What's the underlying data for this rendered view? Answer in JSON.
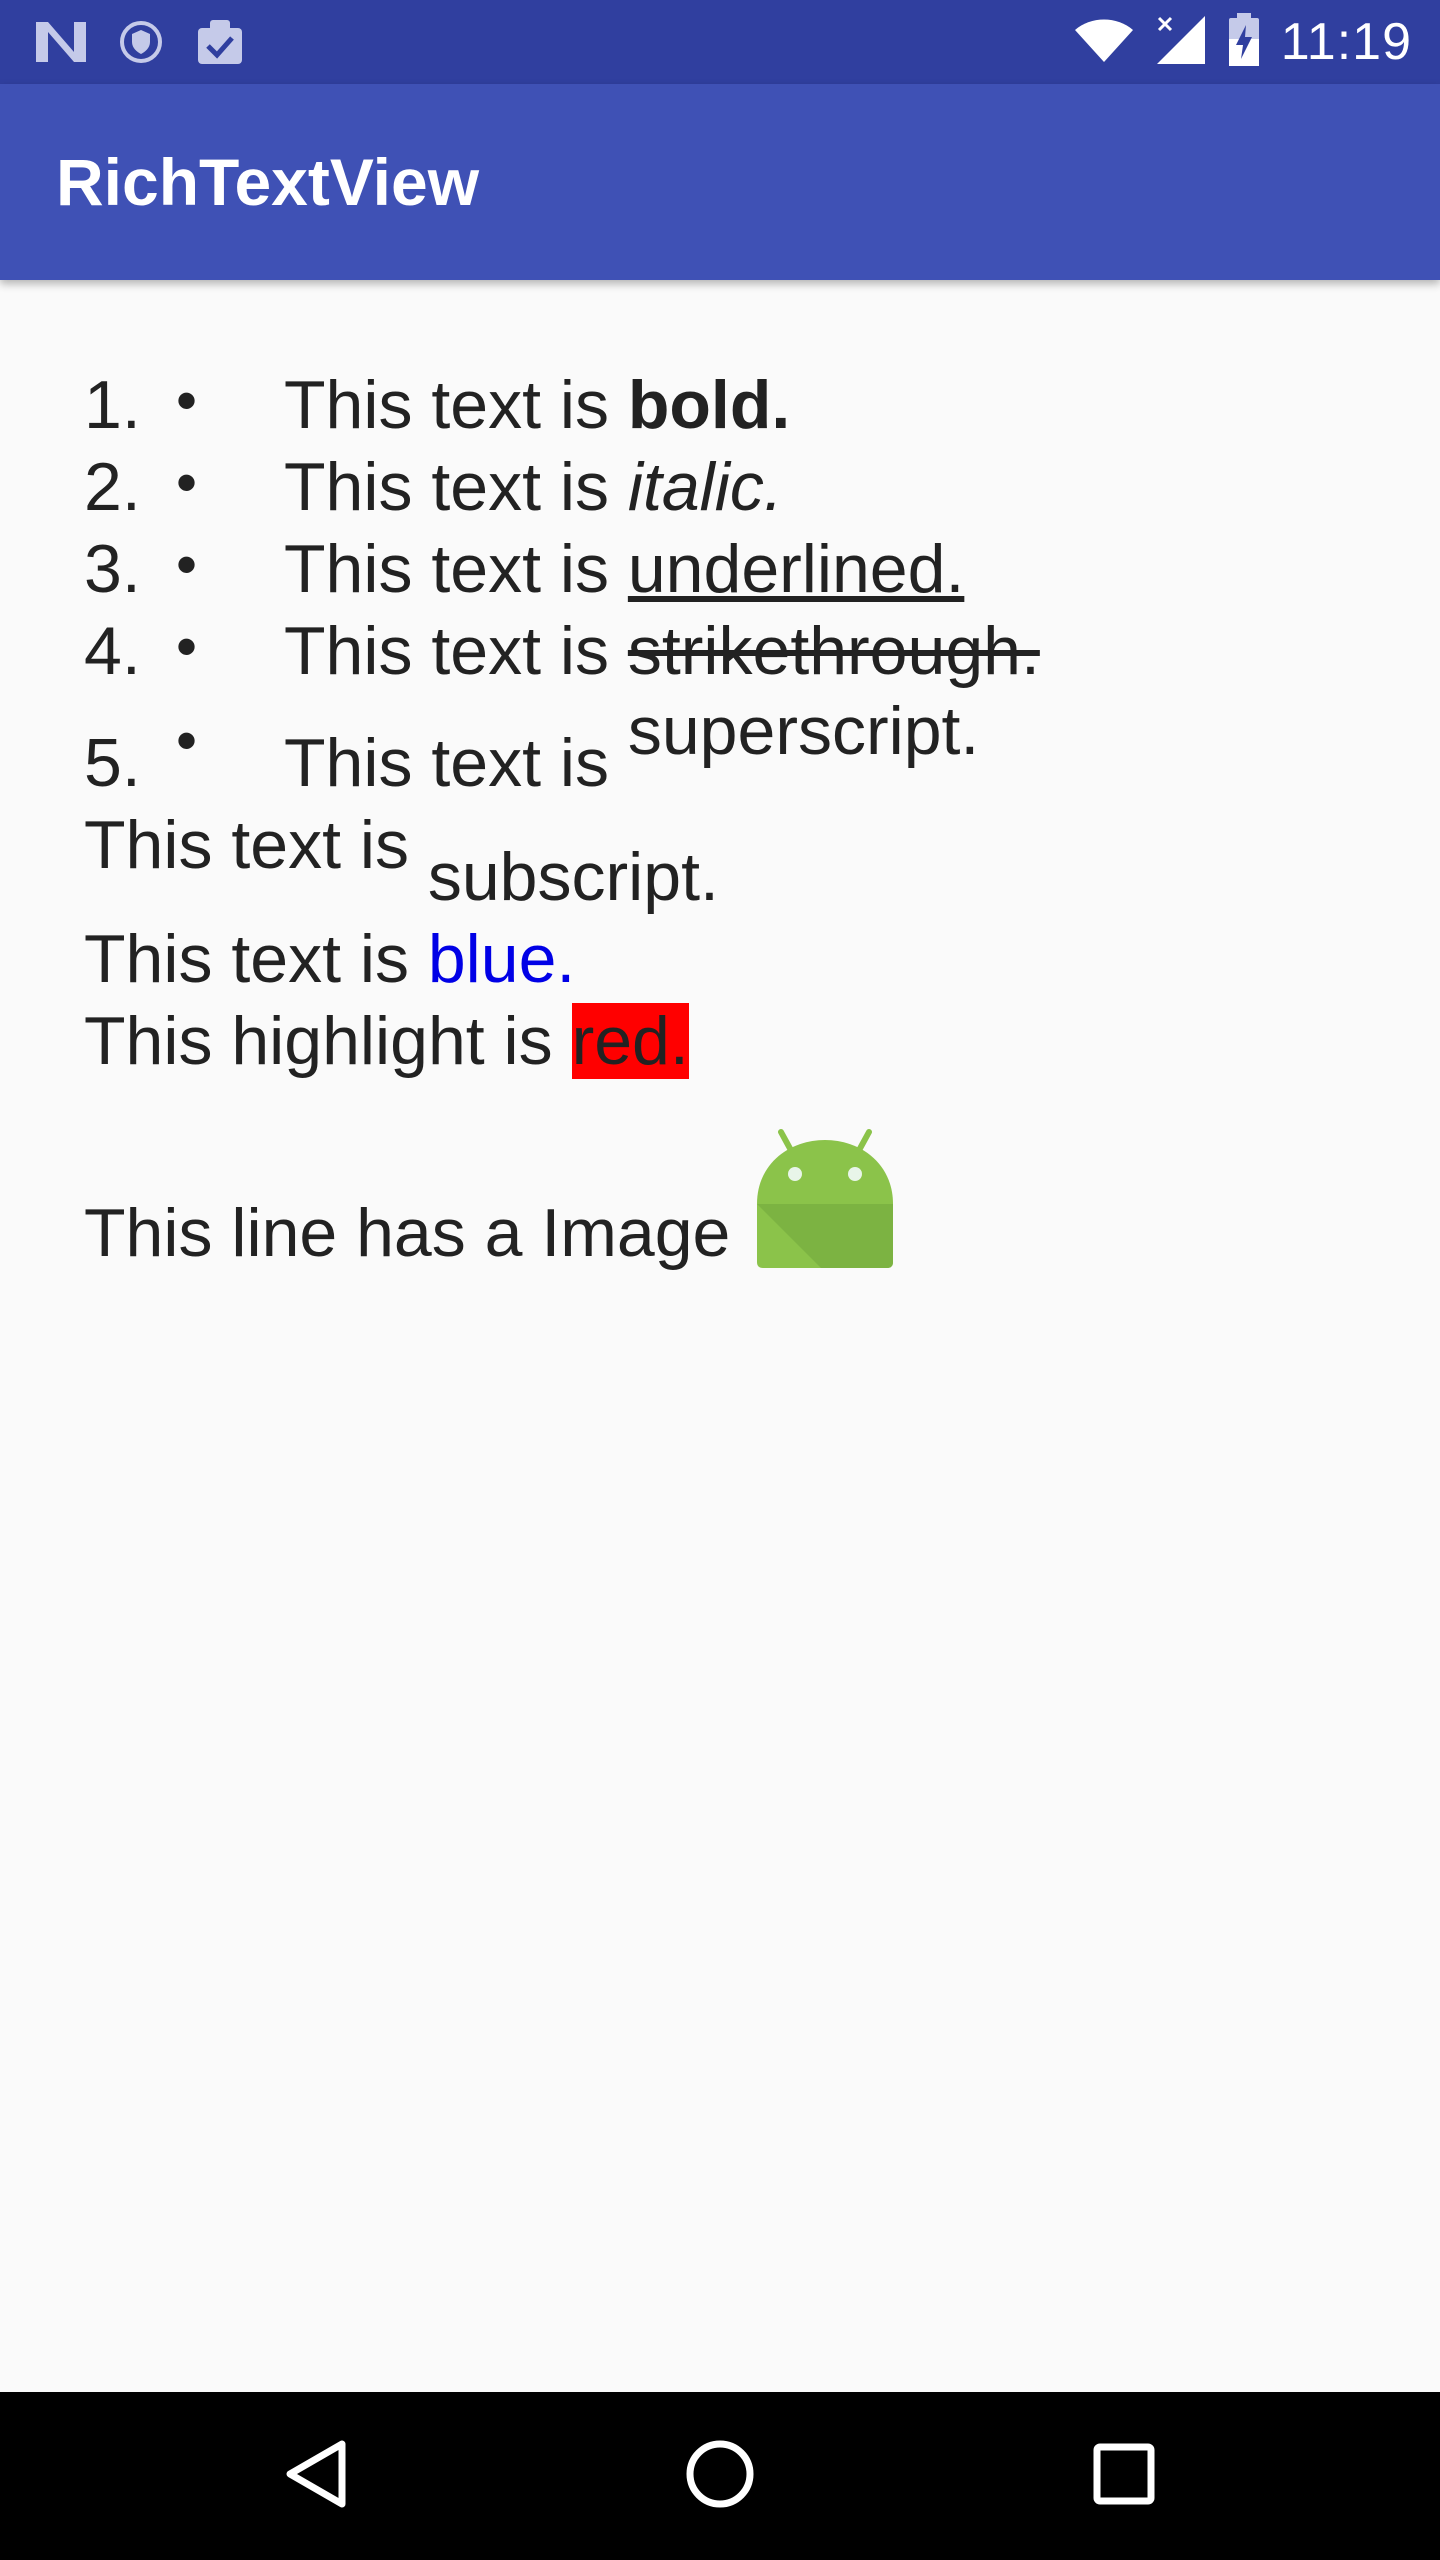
{
  "status_bar": {
    "time": "11:19",
    "left_icons": [
      "n-logo-icon",
      "shield-icon",
      "clipboard-check-icon"
    ],
    "right_icons": [
      "wifi-icon",
      "signal-icon",
      "battery-charging-icon"
    ]
  },
  "app_bar": {
    "title": "RichTextView"
  },
  "list_items": [
    {
      "number": "1.",
      "bullet": "•",
      "prefix": "This text is ",
      "styled": "bold.",
      "style": "bold"
    },
    {
      "number": "2.",
      "bullet": "•",
      "prefix": "This text is ",
      "styled": "italic.",
      "style": "italic"
    },
    {
      "number": "3.",
      "bullet": "•",
      "prefix": "This text is ",
      "styled": "underlined.",
      "style": "underline"
    },
    {
      "number": "4.",
      "bullet": "•",
      "prefix": "This text is ",
      "styled": "strikethrough.",
      "style": "strikethrough"
    },
    {
      "number": "5.",
      "bullet": "•",
      "prefix": "This text is ",
      "styled": "superscript.",
      "style": "superscript"
    }
  ],
  "subscript_line": {
    "prefix": "This text is ",
    "styled": "subscript."
  },
  "blue_line": {
    "prefix": "This text is ",
    "styled": "blue.",
    "color": "#0000e6"
  },
  "highlight_line": {
    "prefix": "This highlight is ",
    "styled": "red.",
    "highlight_color": "#ff0000"
  },
  "image_line": {
    "prefix": "This line has a Image",
    "icon": "android-icon"
  },
  "colors": {
    "status_bar": "#303f9f",
    "app_bar": "#3f51b5",
    "background": "#fafafa",
    "android_green": "#8bc34a"
  },
  "nav_bar": {
    "icons": [
      "back-icon",
      "home-icon",
      "recents-icon"
    ]
  }
}
